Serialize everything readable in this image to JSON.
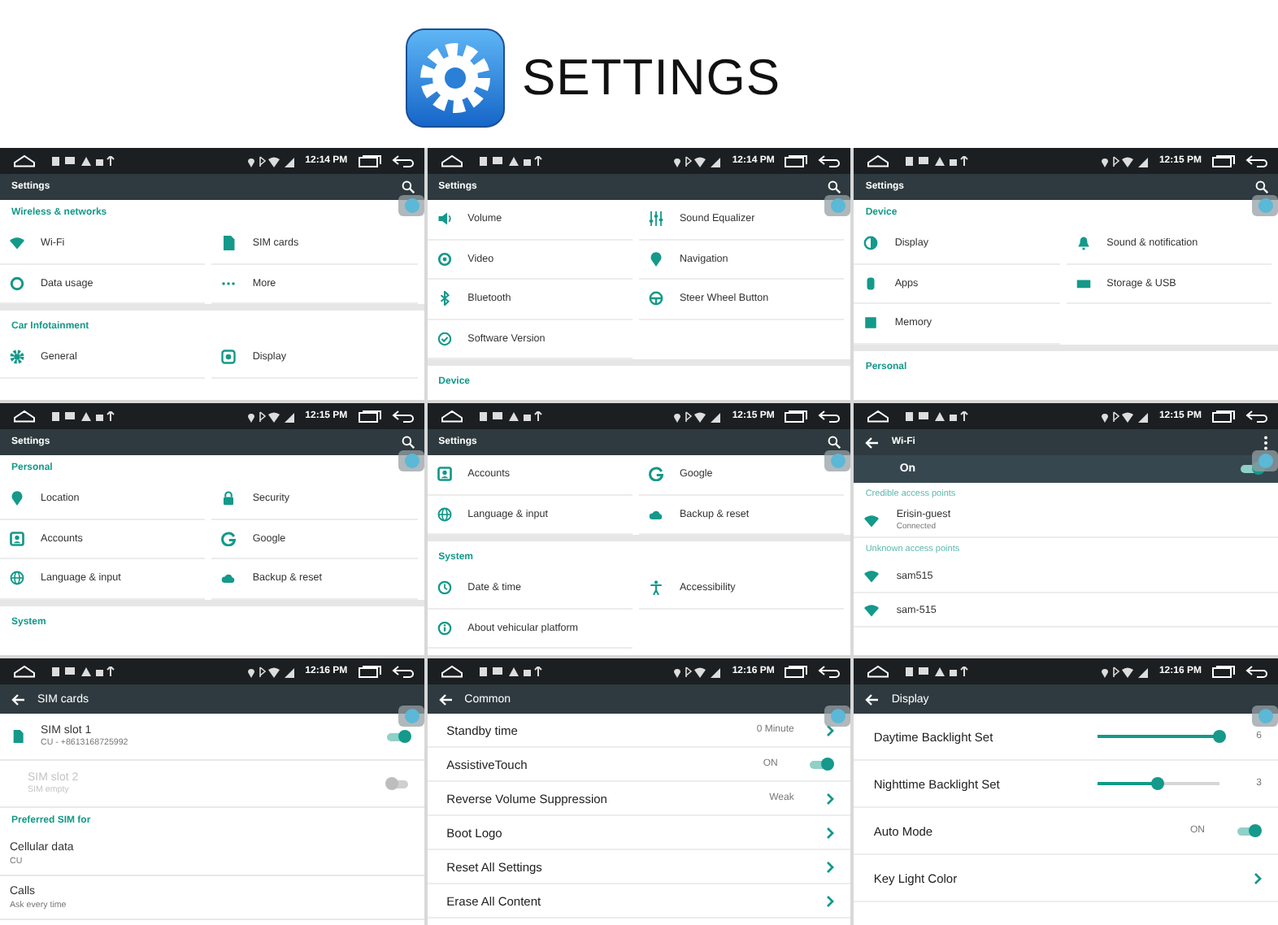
{
  "header": {
    "title": "SETTINGS"
  },
  "panels": [
    {
      "time": "12:14 PM",
      "toolbar": {
        "title": "Settings",
        "back": false,
        "search": true,
        "menu": false
      },
      "blocks": [
        {
          "kind": "header",
          "text": "Wireless & networks"
        },
        {
          "kind": "grid",
          "items": [
            "Wi-Fi",
            "SIM cards",
            "Data usage",
            "More"
          ]
        },
        {
          "kind": "header",
          "text": "Car Infotainment"
        },
        {
          "kind": "grid",
          "items": [
            "General",
            "Display"
          ]
        }
      ]
    },
    {
      "time": "12:14 PM",
      "toolbar": {
        "title": "Settings",
        "back": false,
        "search": true,
        "menu": false
      },
      "blocks": [
        {
          "kind": "grid",
          "items": [
            "Volume",
            "Sound Equalizer",
            "Video",
            "Navigation",
            "Bluetooth",
            "Steer Wheel Button",
            "Software Version"
          ]
        },
        {
          "kind": "header",
          "text": "Device"
        }
      ]
    },
    {
      "time": "12:15 PM",
      "toolbar": {
        "title": "Settings",
        "back": false,
        "search": true,
        "menu": false
      },
      "blocks": [
        {
          "kind": "header",
          "text": "Device"
        },
        {
          "kind": "grid",
          "items": [
            "Display",
            "Sound & notification",
            "Apps",
            "Storage & USB",
            "Memory"
          ]
        },
        {
          "kind": "header",
          "text": "Personal"
        }
      ]
    },
    {
      "time": "12:15 PM",
      "toolbar": {
        "title": "Settings",
        "back": false,
        "search": true,
        "menu": false
      },
      "blocks": [
        {
          "kind": "header",
          "text": "Personal"
        },
        {
          "kind": "grid",
          "items": [
            "Location",
            "Security",
            "Accounts",
            "Google",
            "Language & input",
            "Backup & reset"
          ]
        },
        {
          "kind": "header",
          "text": "System"
        }
      ]
    },
    {
      "time": "12:15 PM",
      "toolbar": {
        "title": "Settings",
        "back": false,
        "search": true,
        "menu": false
      },
      "blocks": [
        {
          "kind": "grid",
          "items": [
            "Accounts",
            "Google",
            "Language & input",
            "Backup & reset"
          ]
        },
        {
          "kind": "header",
          "text": "System"
        },
        {
          "kind": "grid",
          "items": [
            "Date & time",
            "Accessibility",
            "About vehicular platform"
          ]
        }
      ]
    },
    {
      "time": "12:15 PM",
      "toolbar": {
        "title": "Wi-Fi",
        "back": true,
        "search": false,
        "menu": true
      },
      "blocks": [
        {
          "kind": "switch-bar",
          "label": "On",
          "on": true
        },
        {
          "kind": "header",
          "text": "Credible access points"
        },
        {
          "kind": "network",
          "name": "Erisin-guest",
          "status": "Connected"
        },
        {
          "kind": "header",
          "text": "Unknown access points"
        },
        {
          "kind": "network",
          "name": "sam515"
        },
        {
          "kind": "network",
          "name": "sam-515"
        }
      ]
    },
    {
      "time": "12:16 PM",
      "toolbar": {
        "title": "SIM cards",
        "back": true,
        "search": false,
        "menu": false
      },
      "blocks": [
        {
          "kind": "sim",
          "title": "SIM slot 1",
          "subtitle": "CU - +8613168725992",
          "on": true,
          "disabled": false
        },
        {
          "kind": "sim",
          "title": "SIM slot 2",
          "subtitle": "SIM empty",
          "on": false,
          "disabled": true
        },
        {
          "kind": "header",
          "text": "Preferred SIM for"
        },
        {
          "kind": "detail",
          "title": "Cellular data",
          "subtitle": "CU"
        },
        {
          "kind": "detail",
          "title": "Calls",
          "subtitle": "Ask every time"
        }
      ]
    },
    {
      "time": "12:16 PM",
      "toolbar": {
        "title": "Common",
        "back": true,
        "search": false,
        "menu": false
      },
      "blocks": [
        {
          "kind": "link",
          "label": "Standby time",
          "value": "0 Minute"
        },
        {
          "kind": "toggle",
          "label": "AssistiveTouch",
          "value": "ON",
          "on": true
        },
        {
          "kind": "link",
          "label": "Reverse Volume Suppression",
          "value": "Weak"
        },
        {
          "kind": "link",
          "label": "Boot Logo"
        },
        {
          "kind": "link",
          "label": "Reset All Settings"
        },
        {
          "kind": "link",
          "label": "Erase All Content"
        }
      ]
    },
    {
      "time": "12:16 PM",
      "toolbar": {
        "title": "Display",
        "back": true,
        "search": false,
        "menu": false
      },
      "blocks": [
        {
          "kind": "slider",
          "label": "Daytime Backlight Set",
          "level": 1.0,
          "reading": "6"
        },
        {
          "kind": "slider",
          "label": "Nighttime Backlight Set",
          "level": 0.5,
          "reading": "3"
        },
        {
          "kind": "toggle",
          "label": "Auto Mode",
          "value": "ON",
          "on": true
        },
        {
          "kind": "link",
          "label": "Key Light Color"
        }
      ]
    }
  ]
}
